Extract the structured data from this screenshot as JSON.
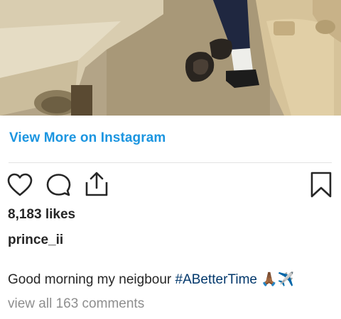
{
  "post": {
    "view_more_label": "View More on Instagram",
    "likes_text": "8,183 likes",
    "username": "prince_ii",
    "caption_text": "Good morning my neigbour ",
    "caption_hashtag": "#ABetterTime",
    "caption_emoji": "🙏🏾✈️",
    "comments_link": "view all 163 comments"
  },
  "icons": {
    "like": "heart-icon",
    "comment": "comment-bubble-icon",
    "share": "share-upload-icon",
    "save": "bookmark-icon"
  },
  "colors": {
    "link_blue": "#1b95e0",
    "hashtag": "#00376b",
    "muted": "#8e8e8e",
    "text": "#262626"
  }
}
